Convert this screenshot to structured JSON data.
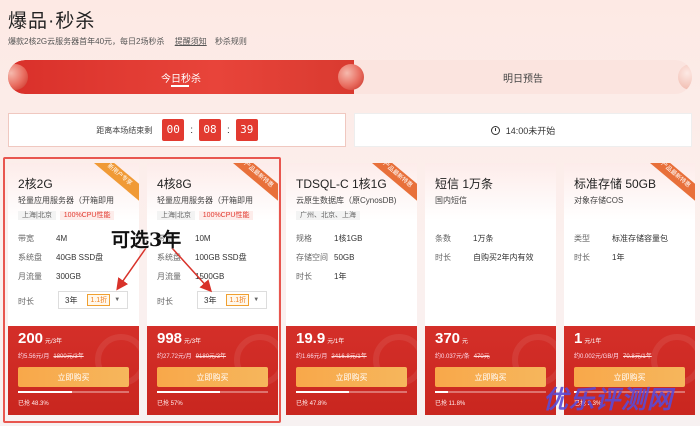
{
  "header": {
    "title": "爆品·秒杀",
    "subtitle": "爆款2核2G云服务器首年40元，每日2场秒杀",
    "reminder_link": "提醒须知",
    "rules_link": "秒杀规则"
  },
  "tabs": {
    "today": "今日秒杀",
    "tomorrow": "明日预告"
  },
  "timer": {
    "label": "距离本场结束剩",
    "hours": "00",
    "minutes": "08",
    "seconds": "39"
  },
  "next_session": "14:00未开始",
  "cards": [
    {
      "ribbon": "新用户专享",
      "name": "2核2G",
      "desc": "轻量应用服务器（开箱即用",
      "region": "上海|北京",
      "perf": "100%CPU性能",
      "specs": [
        {
          "k": "带宽",
          "v": "4M"
        },
        {
          "k": "系统盘",
          "v": "40GB SSD盘"
        },
        {
          "k": "月流量",
          "v": "300GB"
        }
      ],
      "duration_label": "时长",
      "duration": "3年",
      "discount": "1.1折",
      "price": "200",
      "price_unit": "元/3年",
      "per_month": "约5.56元/月",
      "original": "1800元/3年",
      "buy": "立即购买",
      "sold": "已抢 48.3%",
      "progress": 0.483
    },
    {
      "ribbon": "产品最新特惠",
      "name": "4核8G",
      "desc": "轻量应用服务器（开箱即用",
      "region": "上海|北京",
      "perf": "100%CPU性能",
      "specs": [
        {
          "k": "带宽",
          "v": "10M"
        },
        {
          "k": "系统盘",
          "v": "100GB SSD盘"
        },
        {
          "k": "月流量",
          "v": "1500GB"
        }
      ],
      "duration_label": "时长",
      "duration": "3年",
      "discount": "1.1折",
      "price": "998",
      "price_unit": "元/3年",
      "per_month": "约27.72元/月",
      "original": "9180元/3年",
      "buy": "立即购买",
      "sold": "已抢 57%",
      "progress": 0.57
    },
    {
      "ribbon": "产品最新特惠",
      "name": "TDSQL-C 1核1G",
      "desc": "云原生数据库（原CynosDB)",
      "region": "广州、北京、上海",
      "specs": [
        {
          "k": "规格",
          "v": "1核1GB"
        },
        {
          "k": "存储空间",
          "v": "50GB"
        },
        {
          "k": "时长",
          "v": "1年"
        }
      ],
      "price": "19.9",
      "price_unit": "元/1年",
      "per_month": "约1.66元/月",
      "original": "2416.8元/1年",
      "buy": "立即购买",
      "sold": "已抢 47.8%",
      "progress": 0.478
    },
    {
      "name": "短信 1万条",
      "desc": "国内短信",
      "specs": [
        {
          "k": "条数",
          "v": "1万条"
        },
        {
          "k": "时长",
          "v": "自购买2年内有效"
        }
      ],
      "price": "370",
      "price_unit": "元",
      "per_month": "约0.037元/条",
      "original": "470元",
      "buy": "立即购买",
      "sold": "已抢 11.8%",
      "progress": 0.118
    },
    {
      "ribbon": "产品最新特惠",
      "name": "标准存储 50GB",
      "desc": "对象存储COS",
      "specs": [
        {
          "k": "类型",
          "v": "标准存储容量包"
        },
        {
          "k": "时长",
          "v": "1年"
        }
      ],
      "price": "1",
      "price_unit": "元/1年",
      "per_month": "约0.002元/GB/月",
      "original": "70.8元/1年",
      "buy": "立即购买",
      "sold": "已抢 2.3%",
      "progress": 0.023
    }
  ],
  "annotation": "可选3年",
  "watermark": "优乐评测网",
  "colors": {
    "accent_red": "#e23a30",
    "buy_orange": "#f8a84a",
    "annotation_box": "#e8564f"
  }
}
